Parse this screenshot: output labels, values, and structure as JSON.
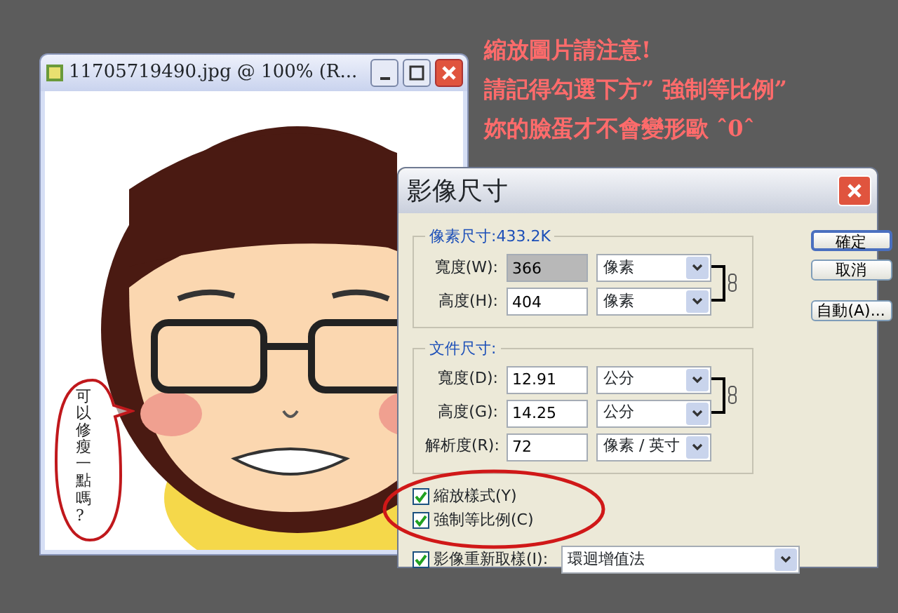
{
  "annotation": {
    "lines": [
      "縮放圖片請注意!",
      "請記得勾選下方” 強制等比例”",
      "妳的臉蛋才不會變形歐 ˆ0ˆ"
    ]
  },
  "image_window": {
    "title": "11705719490.jpg @ 100% (R...",
    "speech_bubble": "可以修瘦一點嗎?"
  },
  "dialog": {
    "title": "影像尺寸",
    "groups": [
      {
        "legend": "像素尺寸:433.2K",
        "linked": true,
        "fields": [
          {
            "label": "寬度(W):",
            "value": "366",
            "selected": true,
            "unit": "像素"
          },
          {
            "label": "高度(H):",
            "value": "404",
            "selected": false,
            "unit": "像素"
          }
        ]
      },
      {
        "legend": "文件尺寸:",
        "linked": true,
        "fields": [
          {
            "label": "寬度(D):",
            "value": "12.91",
            "selected": false,
            "unit": "公分"
          },
          {
            "label": "高度(G):",
            "value": "14.25",
            "selected": false,
            "unit": "公分"
          },
          {
            "label": "解析度(R):",
            "value": "72",
            "selected": false,
            "unit": "像素 / 英寸"
          }
        ]
      }
    ],
    "buttons": [
      {
        "label": "確定",
        "default": true
      },
      {
        "label": "取消",
        "default": false
      },
      {
        "label": "自動(A)...",
        "default": false
      }
    ],
    "options": [
      {
        "kind": "checkbox",
        "label": "縮放樣式(Y)",
        "checked": true
      },
      {
        "kind": "checkbox",
        "label": "強制等比例(C)",
        "checked": true
      },
      {
        "kind": "resample",
        "label": "影像重新取樣(I):",
        "checked": true,
        "method": "環迴增值法"
      }
    ]
  }
}
